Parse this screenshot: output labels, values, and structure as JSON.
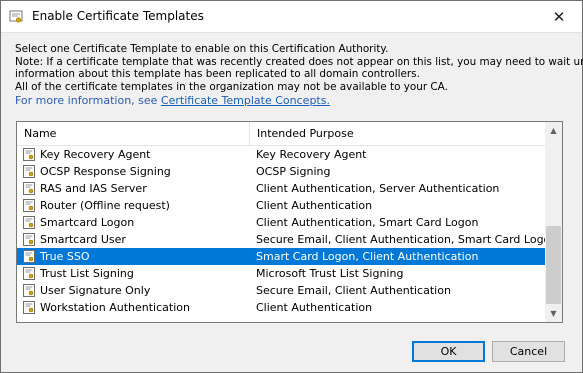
{
  "window": {
    "title": "Enable Certificate Templates",
    "close_glyph": "✕"
  },
  "intro": {
    "lines": [
      "Select one Certificate Template to enable on this Certification Authority.",
      "Note: If a certificate template that was recently created does not appear on this list, you may need to wait until",
      "information about this template has been replicated to all domain controllers.",
      "All of the certificate templates in the organization may not be available to your CA."
    ],
    "link_prefix": "For more information, see ",
    "link_text": "Certificate Template Concepts.",
    "link_color": "#1a5fb4"
  },
  "list": {
    "columns": [
      "Name",
      "Intended Purpose"
    ],
    "rows": [
      {
        "name": "Key Recovery Agent",
        "purpose": "Key Recovery Agent"
      },
      {
        "name": "OCSP Response Signing",
        "purpose": "OCSP Signing"
      },
      {
        "name": "RAS and IAS Server",
        "purpose": "Client Authentication, Server Authentication"
      },
      {
        "name": "Router (Offline request)",
        "purpose": "Client Authentication"
      },
      {
        "name": "Smartcard Logon",
        "purpose": "Client Authentication, Smart Card Logon"
      },
      {
        "name": "Smartcard User",
        "purpose": "Secure Email, Client Authentication, Smart Card Logon"
      },
      {
        "name": "True SSO",
        "purpose": "Smart Card Logon, Client Authentication",
        "selected": true
      },
      {
        "name": "Trust List Signing",
        "purpose": "Microsoft Trust List Signing"
      },
      {
        "name": "User Signature Only",
        "purpose": "Secure Email, Client Authentication"
      },
      {
        "name": "Workstation Authentication",
        "purpose": "Client Authentication"
      }
    ],
    "row_icon": "certificate-template-icon",
    "selection_color": "#0078d7"
  },
  "scrollbar": {
    "up_glyph": "▲",
    "down_glyph": "▼"
  },
  "buttons": {
    "ok": "OK",
    "cancel": "Cancel"
  }
}
